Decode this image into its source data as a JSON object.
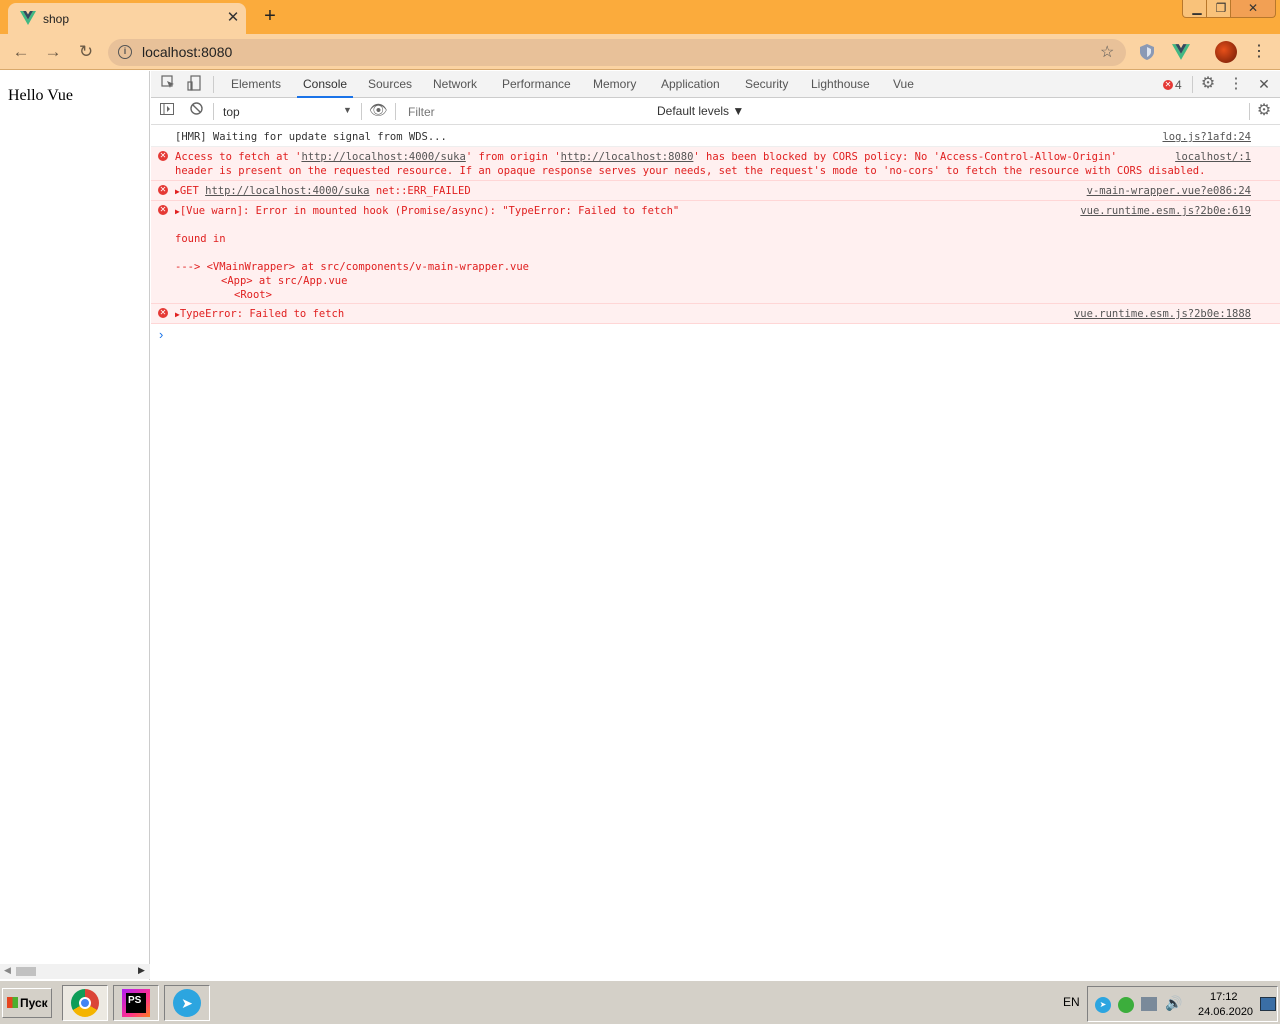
{
  "browser": {
    "tab_title": "shop",
    "tab_close": "✕",
    "new_tab": "+",
    "window_controls": {
      "minimize": "▁",
      "maximize": "❐",
      "close": "✕"
    },
    "address": "localhost:8080"
  },
  "page": {
    "text": "Hello Vue"
  },
  "devtools": {
    "tabs": [
      "Elements",
      "Console",
      "Sources",
      "Network",
      "Performance",
      "Memory",
      "Application",
      "Security",
      "Lighthouse",
      "Vue"
    ],
    "active_tab": "Console",
    "error_count": "4",
    "context": "top",
    "filter_placeholder": "Filter",
    "levels": "Default levels ▼",
    "console": {
      "hmr": {
        "text": "[HMR] Waiting for update signal from WDS...",
        "source": "log.js?1afd:24"
      },
      "cors": {
        "line1_a": "Access to fetch at '",
        "url1": "http://localhost:4000/suka",
        "line1_b": "' from origin '",
        "url2": "http://localhost:8080",
        "line1_c": "' has been blocked by CORS policy: No 'Access-Control-Allow-Origin'",
        "line2": "header is present on the requested resource. If an opaque response serves your needs, set the request's mode to 'no-cors' to fetch the resource with CORS disabled.",
        "source": "localhost/:1"
      },
      "get": {
        "method": "GET",
        "url": "http://localhost:4000/suka",
        "status": "net::ERR_FAILED",
        "source": "v-main-wrapper.vue?e086:24"
      },
      "vue_warn": {
        "text": "[Vue warn]: Error in mounted hook (Promise/async): \"TypeError: Failed to fetch\"",
        "found_in": "found in",
        "trace1": "---> <VMainWrapper> at src/components/v-main-wrapper.vue",
        "trace2": "<App> at src/App.vue",
        "trace3": "<Root>",
        "source": "vue.runtime.esm.js?2b0e:619"
      },
      "type_error": {
        "text": "TypeError: Failed to fetch",
        "source": "vue.runtime.esm.js?2b0e:1888"
      }
    }
  },
  "taskbar": {
    "start": "Пуск",
    "ps_label": "PS",
    "lang": "EN",
    "time": "17:12",
    "date": "24.06.2020"
  }
}
